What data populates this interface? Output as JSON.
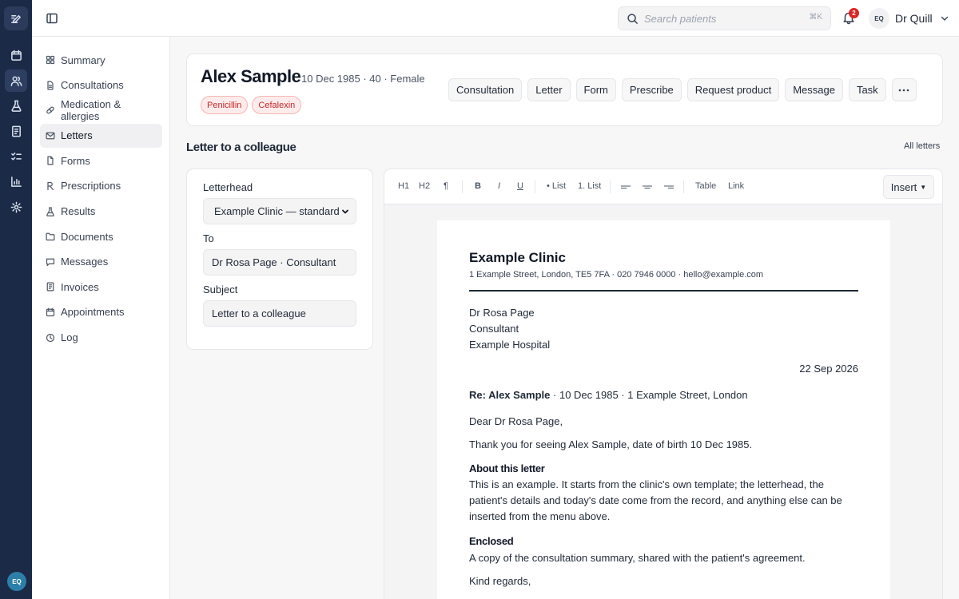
{
  "topbar": {
    "search_placeholder": "Search patients",
    "search_shortcut": "⌘K",
    "notification_count": "2",
    "user_initials": "EQ",
    "user_name": "Dr Quill"
  },
  "rail": {
    "icons": [
      "calendar-icon",
      "users-icon",
      "flask-icon",
      "invoice-icon",
      "checklist-icon",
      "bar-chart-icon",
      "gear-icon"
    ],
    "active_index": 1,
    "avatar_initials": "EQ"
  },
  "sidebar": {
    "active_index": 3,
    "items": [
      {
        "label": "Summary",
        "icon": "grid-icon"
      },
      {
        "label": "Consultations",
        "icon": "document-icon"
      },
      {
        "label": "Medication & allergies",
        "icon": "pill-icon"
      },
      {
        "label": "Letters",
        "icon": "mail-icon"
      },
      {
        "label": "Forms",
        "icon": "form-icon"
      },
      {
        "label": "Prescriptions",
        "icon": "rx-icon"
      },
      {
        "label": "Results",
        "icon": "flask-icon"
      },
      {
        "label": "Documents",
        "icon": "folder-icon"
      },
      {
        "label": "Messages",
        "icon": "message-icon"
      },
      {
        "label": "Invoices",
        "icon": "invoice-icon"
      },
      {
        "label": "Appointments",
        "icon": "calendar-icon"
      },
      {
        "label": "Log",
        "icon": "clock-icon"
      }
    ]
  },
  "patient": {
    "name": "Alex Sample",
    "meta": "10 Dec 1985 · 40 · Female",
    "allergies": [
      "Penicillin",
      "Cefalexin"
    ],
    "actions": [
      "Consultation",
      "Letter",
      "Form",
      "Prescribe",
      "Request product",
      "Message",
      "Task"
    ]
  },
  "section": {
    "title": "Letter to a colleague",
    "all_letters": "All letters"
  },
  "form": {
    "letterhead_label": "Letterhead",
    "letterhead_value": "Example Clinic — standard",
    "to_label": "To",
    "to_value": "Dr Rosa Page · Consultant",
    "subject_label": "Subject",
    "subject_value": "Letter to a colleague"
  },
  "toolbar": {
    "h1": "H1",
    "h2": "H2",
    "paragraph": "¶",
    "bold": "B",
    "italic": "I",
    "underline": "U",
    "bullet_list": "• List",
    "numbered_list": "1. List",
    "table": "Table",
    "link": "Link",
    "insert": "Insert"
  },
  "letter": {
    "clinic_name": "Example Clinic",
    "clinic_address": "1 Example Street, London, TE5 7FA · 020 7946 0000 · hello@example.com",
    "recipient_name": "Dr Rosa Page",
    "recipient_role": "Consultant",
    "recipient_org": "Example Hospital",
    "date": "22 Sep 2026",
    "re_label": "Re: Alex Sample",
    "re_details": " · 10 Dec 1985 · 1 Example Street, London",
    "salutation": "Dear Dr Rosa Page,",
    "intro": "Thank you for seeing Alex Sample, date of birth 10 Dec 1985.",
    "about_heading": "About this letter",
    "about_body": "This is an example. It starts from the clinic's own template; the letterhead, the patient's details and today's date come from the record, and anything else can be inserted from the menu above.",
    "enclosed_heading": "Enclosed",
    "enclosed_body": "A copy of the consultation summary, shared with the patient's agreement.",
    "closing": "Kind regards,"
  }
}
